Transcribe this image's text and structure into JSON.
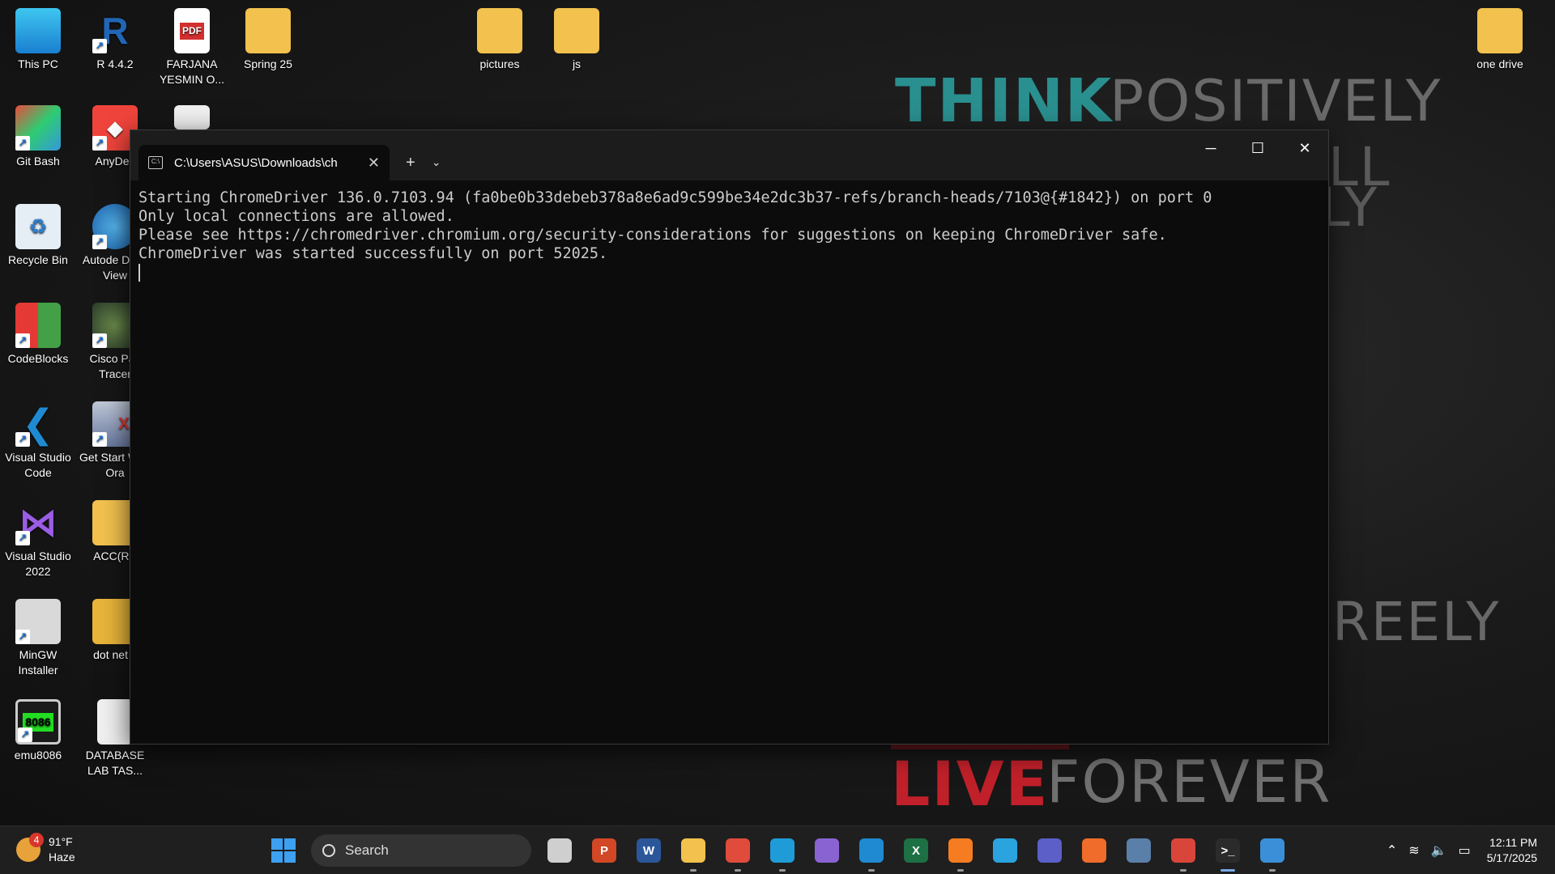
{
  "wallpaper": {
    "think": "THINK",
    "positively": "POSITIVELY",
    "ll": "LL",
    "ly": "LY",
    "freely": "REELY",
    "live": "LIVE",
    "forever": "FOREVER"
  },
  "desktop": {
    "icons": [
      {
        "label": "This PC"
      },
      {
        "label": "R 4.4.2"
      },
      {
        "label": "FARJANA YESMIN O..."
      },
      {
        "label": "Spring 25"
      },
      {
        "label": "pictures"
      },
      {
        "label": "js"
      },
      {
        "label": "one drive"
      },
      {
        "label": "Git Bash"
      },
      {
        "label": "AnyDes"
      },
      {
        "label": "Recycle Bin"
      },
      {
        "label": "Autode DWF View"
      },
      {
        "label": "CodeBlocks"
      },
      {
        "label": "Cisco Pac Tracer"
      },
      {
        "label": "Visual Studio Code"
      },
      {
        "label": "Get Start With Ora"
      },
      {
        "label": "Visual Studio 2022"
      },
      {
        "label": "ACC(R&"
      },
      {
        "label": "MinGW Installer"
      },
      {
        "label": "dot net c"
      },
      {
        "label": "emu8086"
      },
      {
        "label": "DATABASE LAB TAS..."
      }
    ],
    "pdf_badge": "PDF",
    "emu_badge": "8086"
  },
  "terminal": {
    "tab_title": "C:\\Users\\ASUS\\Downloads\\ch",
    "lines": [
      "Starting ChromeDriver 136.0.7103.94 (fa0be0b33debeb378a8e6ad9c599be34e2dc3b37-refs/branch-heads/7103@{#1842}) on port 0",
      "Only local connections are allowed.",
      "Please see https://chromedriver.chromium.org/security-considerations for suggestions on keeping ChromeDriver safe.",
      "ChromeDriver was started successfully on port 52025."
    ]
  },
  "taskbar": {
    "weather_temp": "91°F",
    "weather_desc": "Haze",
    "weather_badge": "4",
    "search_placeholder": "Search",
    "time": "12:11 PM",
    "date": "5/17/2025",
    "apps": [
      {
        "icon": "task-view-icon",
        "text": "",
        "color": "#cfcfcf"
      },
      {
        "icon": "powerpoint-icon",
        "text": "P",
        "color": "#d24726"
      },
      {
        "icon": "word-icon",
        "text": "W",
        "color": "#2b579a"
      },
      {
        "icon": "file-explorer-icon",
        "text": "",
        "color": "#f2c14e"
      },
      {
        "icon": "chrome-icon",
        "text": "",
        "color": "#e04b3c"
      },
      {
        "icon": "edge-icon",
        "text": "",
        "color": "#1f9cd8"
      },
      {
        "icon": "copilot-icon",
        "text": "",
        "color": "#8a63d2"
      },
      {
        "icon": "vscode-icon",
        "text": "",
        "color": "#1f8ad2"
      },
      {
        "icon": "excel-icon",
        "text": "X",
        "color": "#1d7044"
      },
      {
        "icon": "xampp-icon",
        "text": "",
        "color": "#f57c20"
      },
      {
        "icon": "telegram-icon",
        "text": "",
        "color": "#2aa3df"
      },
      {
        "icon": "teams-icon",
        "text": "",
        "color": "#5b5fc7"
      },
      {
        "icon": "postman-icon",
        "text": "",
        "color": "#ef6c2a"
      },
      {
        "icon": "postgresql-icon",
        "text": "",
        "color": "#5a7fa8"
      },
      {
        "icon": "chrome-profile-icon",
        "text": "",
        "color": "#d9453a"
      },
      {
        "icon": "terminal-icon",
        "text": ">_",
        "color": "#2b2b2b"
      },
      {
        "icon": "snipping-icon",
        "text": "",
        "color": "#3a8fd8"
      }
    ]
  }
}
